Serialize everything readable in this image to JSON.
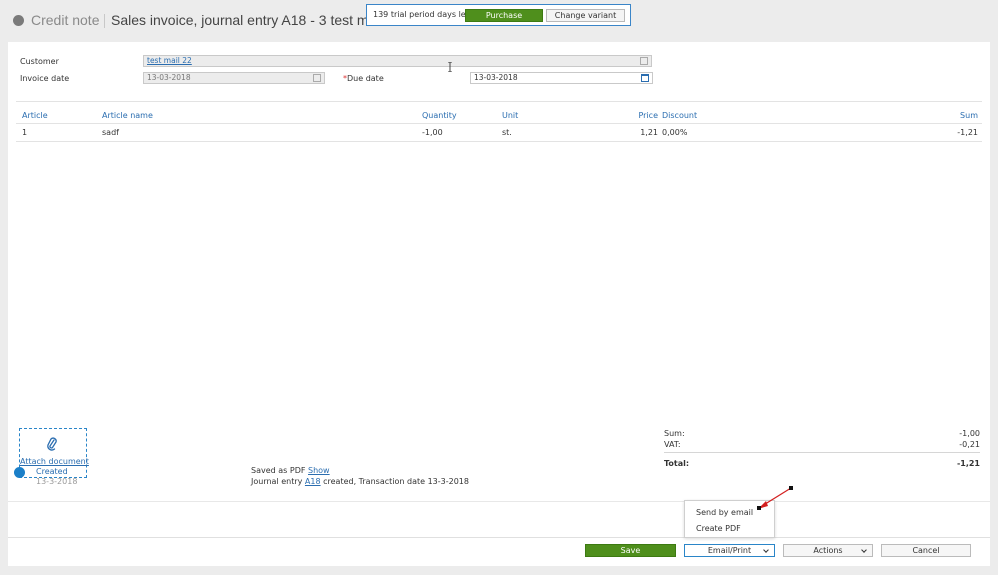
{
  "header": {
    "doc_type": "Credit note",
    "title": "Sales invoice, journal entry A18 - 3 test ma..."
  },
  "trial": {
    "text": "139 trial period days left",
    "purchase_label": "Purchase",
    "change_label": "Change variant"
  },
  "form": {
    "customer_label": "Customer",
    "customer_value": "test mail 22",
    "invoice_date_label": "Invoice date",
    "invoice_date_value": "13-03-2018",
    "due_date_required": "*",
    "due_date_label": "Due date",
    "due_date_value": "13-03-2018"
  },
  "table": {
    "headers": {
      "article": "Article",
      "article_name": "Article name",
      "quantity": "Quantity",
      "unit": "Unit",
      "price": "Price",
      "discount": "Discount",
      "sum": "Sum"
    },
    "rows": [
      {
        "article": "1",
        "article_name": "sadf",
        "quantity": "-1,00",
        "unit": "st.",
        "price": "1,21",
        "discount": "0,00%",
        "sum": "-1,21"
      }
    ]
  },
  "attach": {
    "label": "Attach document",
    "icon": "paperclip-icon"
  },
  "totals": {
    "sum_label": "Sum:",
    "sum_value": "-1,00",
    "vat_label": "VAT:",
    "vat_value": "-0,21",
    "total_label": "Total:",
    "total_value": "-1,21"
  },
  "history": {
    "status": "Created",
    "date": "13-3-2018",
    "pdf_text": "Saved as PDF",
    "pdf_link": "Show",
    "journal_prefix": "Journal entry",
    "journal_link": "A18",
    "journal_suffix": "created, Transaction date 13-3-2018"
  },
  "dropdown": {
    "send_email": "Send by email",
    "create_pdf": "Create PDF"
  },
  "footer": {
    "save": "Save",
    "email_print": "Email/Print",
    "actions": "Actions",
    "cancel": "Cancel"
  },
  "colors": {
    "accent_blue": "#2a6db0",
    "save_green": "#4f8f1c",
    "annotation_red": "#d32020"
  }
}
